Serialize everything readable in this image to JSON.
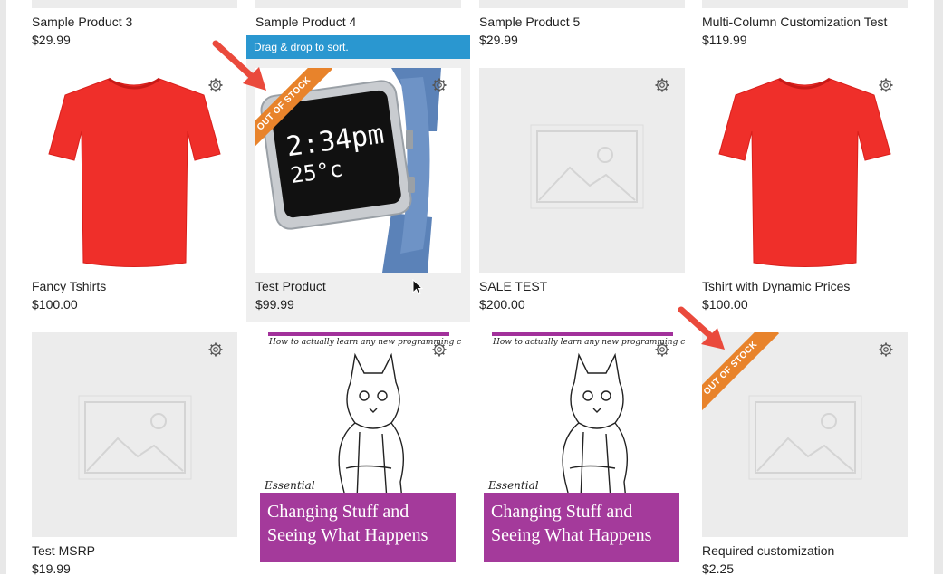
{
  "sort_hint": "Drag & drop to sort.",
  "badge_out_of_stock": "OUT OF STOCK",
  "accent_blue": "#2a97d0",
  "ribbon_orange": "#e8832b",
  "rows": [
    {
      "products": [
        {
          "name": "Sample Product 3",
          "price": "$29.99"
        },
        {
          "name": "Sample Product 4",
          "price": ""
        },
        {
          "name": "Sample Product 5",
          "price": "$29.99"
        },
        {
          "name": "Multi-Column Customization Test",
          "price": "$119.99"
        }
      ]
    },
    {
      "products": [
        {
          "name": "Fancy Tshirts",
          "price": "$100.00",
          "image": "red-tshirt"
        },
        {
          "name": "Test Product",
          "price": "$99.99",
          "image": "smartwatch",
          "out_of_stock": true
        },
        {
          "name": "SALE TEST",
          "price": "$200.00",
          "image": "placeholder"
        },
        {
          "name": "Tshirt with Dynamic Prices",
          "price": "$100.00",
          "image": "red-tshirt"
        }
      ]
    },
    {
      "products": [
        {
          "name": "Test MSRP",
          "price": "$19.99",
          "image": "placeholder"
        },
        {
          "name": "",
          "price": "",
          "image": "book-cover"
        },
        {
          "name": "",
          "price": "",
          "image": "book-cover"
        },
        {
          "name": "Required customization",
          "price": "$2.25",
          "image": "placeholder",
          "out_of_stock": true
        }
      ]
    }
  ],
  "book_cover": {
    "subtitle": "How to actually learn any new programming concept",
    "essential": "Essential",
    "title_line1": "Changing Stuff and",
    "title_line2": "Seeing What Happens"
  },
  "watch_screen": {
    "time": "2:34pm",
    "temp": "25°c"
  },
  "icons": {
    "gear": "gear-icon",
    "arrow": "red-arrow-icon",
    "cursor": "mouse-cursor-icon"
  }
}
